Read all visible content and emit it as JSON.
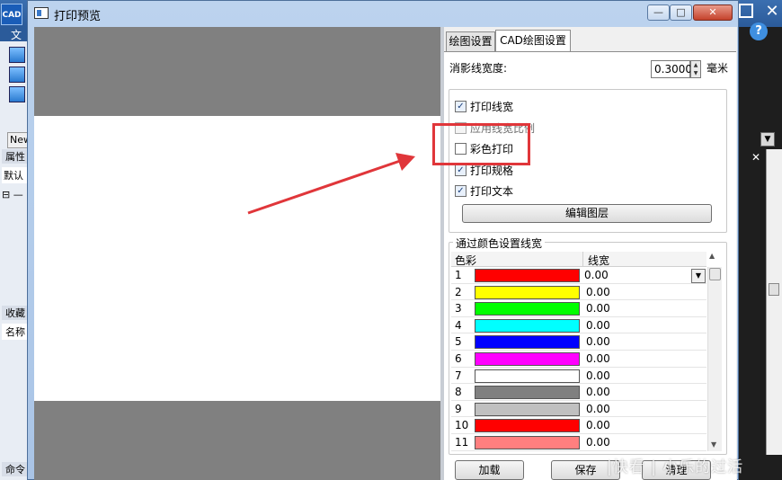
{
  "background_app": {
    "logo_text": "CAD",
    "menu_label": "文",
    "new_tab_label": "New",
    "properties_label": "属性",
    "default_label": "默认",
    "tree_label": "⊟ —",
    "favorites_label": "收藏",
    "name_label": "名称",
    "command_label": "命令",
    "help_icon": "?"
  },
  "dialog": {
    "title": "打印预览",
    "min_label": "—",
    "max_label": "□",
    "close_label": "✕"
  },
  "tabs": [
    {
      "label": "绘图设置",
      "active": false
    },
    {
      "label": "CAD绘图设置",
      "active": true
    }
  ],
  "hide_line_width": {
    "label": "消影线宽度:",
    "value": "0.3000",
    "unit": "毫米"
  },
  "options": [
    {
      "label": "打印线宽",
      "checked": true
    },
    {
      "label": "应用线宽比例",
      "checked": false,
      "disabled": true
    },
    {
      "label": "彩色打印",
      "checked": false
    },
    {
      "label": "打印规格",
      "checked": true
    },
    {
      "label": "打印文本",
      "checked": true
    }
  ],
  "edit_layers_button": "编辑图层",
  "color_group": {
    "title": "通过颜色设置线宽",
    "columns": [
      "色彩",
      "线宽"
    ],
    "rows": [
      {
        "index": "1",
        "color": "#ff0000",
        "width": "0.00"
      },
      {
        "index": "2",
        "color": "#ffff00",
        "width": "0.00"
      },
      {
        "index": "3",
        "color": "#00ff00",
        "width": "0.00"
      },
      {
        "index": "4",
        "color": "#00ffff",
        "width": "0.00"
      },
      {
        "index": "5",
        "color": "#0000ff",
        "width": "0.00"
      },
      {
        "index": "6",
        "color": "#ff00ff",
        "width": "0.00"
      },
      {
        "index": "7",
        "color": "#ffffff",
        "width": "0.00"
      },
      {
        "index": "8",
        "color": "#808080",
        "width": "0.00"
      },
      {
        "index": "9",
        "color": "#c0c0c0",
        "width": "0.00"
      },
      {
        "index": "10",
        "color": "#ff0000",
        "width": "0.00"
      },
      {
        "index": "11",
        "color": "#ff7f7f",
        "width": "0.00"
      }
    ]
  },
  "footer_buttons": {
    "load": "加载",
    "save": "保存",
    "clear": "清理"
  },
  "annotation": {
    "highlight_color": "#e0363a",
    "watermark": "|快看 | 小乐的过活"
  }
}
